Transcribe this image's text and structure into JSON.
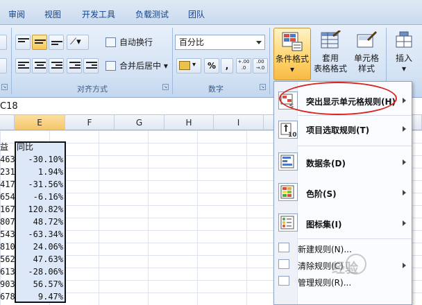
{
  "tabs": [
    "审阅",
    "视图",
    "开发工具",
    "负载测试",
    "团队"
  ],
  "ribbon": {
    "alignment": {
      "wrap_text": "自动换行",
      "merge_center": "合并后居中",
      "merge_arrow": "▾",
      "group_label": "对齐方式"
    },
    "number": {
      "format_value": "百分比",
      "currency_symbol": "▾",
      "percent_symbol": "%",
      "comma_symbol": ",",
      "increase_decimal": "+.00 .0",
      "decrease_decimal": ".00 →.0",
      "group_label": "数字"
    },
    "styles": {
      "conditional_format": "条件格式",
      "conditional_arrow": "▾",
      "table_format_line1": "套用",
      "table_format_line2": "表格格式",
      "cell_styles_line1": "单元格",
      "cell_styles_line2": "样式"
    },
    "cells": {
      "insert_label": "插入",
      "insert_arrow": "▾"
    }
  },
  "formula_bar": {
    "name_box": "C18"
  },
  "columns": [
    {
      "name": "E",
      "selected": true
    },
    {
      "name": "F",
      "selected": false
    },
    {
      "name": "G",
      "selected": false
    },
    {
      "name": "H",
      "selected": false
    },
    {
      "name": "I",
      "selected": false
    }
  ],
  "sheet": {
    "header_left": "益",
    "header_e": "同比",
    "rows": [
      {
        "d": "463",
        "e": "-30.10%"
      },
      {
        "d": "231",
        "e": "1.94%"
      },
      {
        "d": "417",
        "e": "-31.56%"
      },
      {
        "d": "654",
        "e": "-6.16%"
      },
      {
        "d": "167",
        "e": "120.82%"
      },
      {
        "d": "807",
        "e": "48.72%"
      },
      {
        "d": "543",
        "e": "-63.34%"
      },
      {
        "d": "810",
        "e": "24.06%"
      },
      {
        "d": "562",
        "e": "47.63%"
      },
      {
        "d": "613",
        "e": "-28.06%"
      },
      {
        "d": "903",
        "e": "56.57%"
      },
      {
        "d": "678",
        "e": "9.47%"
      }
    ]
  },
  "menu": {
    "items": [
      {
        "label": "突出显示单元格规则(H)",
        "icon": "highlight-rules-icon"
      },
      {
        "label": "项目选取规则(T)",
        "icon": "top-bottom-rules-icon"
      },
      {
        "label": "数据条(D)",
        "icon": "data-bars-icon"
      },
      {
        "label": "色阶(S)",
        "icon": "color-scales-icon"
      },
      {
        "label": "图标集(I)",
        "icon": "icon-sets-icon"
      }
    ],
    "small_items": [
      {
        "label": "新建规则(N)..."
      },
      {
        "label": "清除规则(C)"
      },
      {
        "label": "管理规则(R)..."
      }
    ]
  },
  "watermark": "经验"
}
